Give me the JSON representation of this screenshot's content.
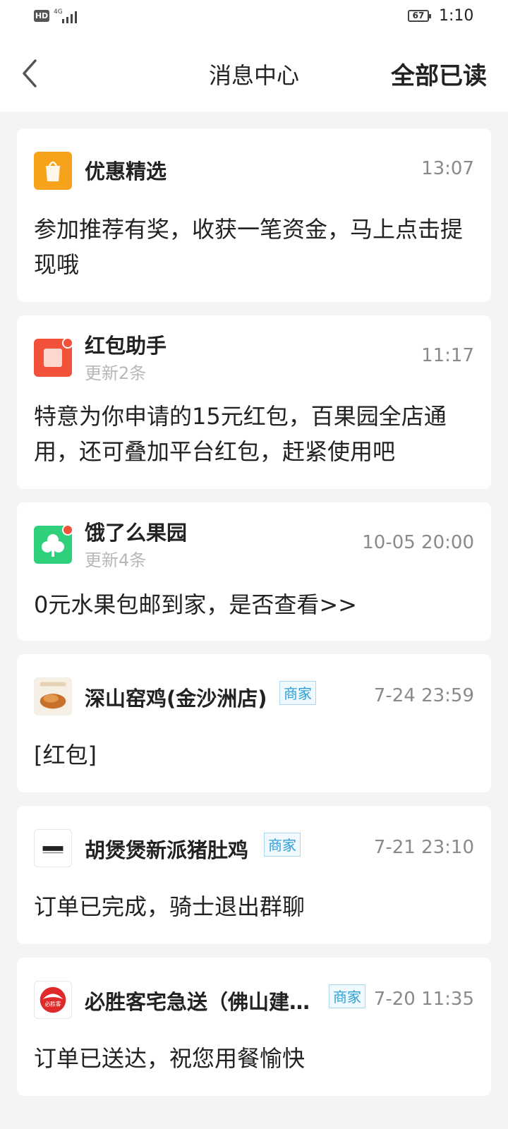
{
  "status_bar": {
    "hd_label": "HD",
    "network_label": "4G",
    "battery_level": "67",
    "time": "1:10"
  },
  "header": {
    "title": "消息中心",
    "mark_all_read_label": "全部已读",
    "back_icon": "chevron-left-icon"
  },
  "messages": [
    {
      "sender": "优惠精选",
      "time": "13:07",
      "preview": "参加推荐有奖，收获一笔资金，马上点击提现哦",
      "icon": "shopping-bag-icon",
      "color": "#f7a21b"
    },
    {
      "sender": "红包助手",
      "sub": "更新2条",
      "time": "11:17",
      "preview": "特意为你申请的15元红包，百果园全店通用，还可叠加平台红包，赶紧使用吧",
      "icon": "red-packet-icon",
      "color": "#f2513a",
      "unread": true
    },
    {
      "sender": "饿了么果园",
      "sub": "更新4条",
      "time": "10-05 20:00",
      "preview": "0元水果包邮到家，是否查看>>",
      "icon": "tree-icon",
      "color": "#2ed07c",
      "unread": true
    },
    {
      "sender": "深山窑鸡(金沙洲店)",
      "badge": "商家",
      "time": "7-24 23:59",
      "preview": "[红包]",
      "icon": "roast-chicken-image"
    },
    {
      "sender": "胡煲煲新派猪肚鸡",
      "badge": "商家",
      "time": "7-21 23:10",
      "preview": "订单已完成，骑士退出群聊",
      "icon": "hubaobao-logo"
    },
    {
      "sender": "必胜客宅急送（佛山建设店）",
      "badge": "商家",
      "time": "7-20 11:35",
      "preview": "订单已送达，祝您用餐愉快",
      "icon": "pizza-hut-logo",
      "logo_text": "必胜客",
      "color": "#e02a2a"
    }
  ]
}
